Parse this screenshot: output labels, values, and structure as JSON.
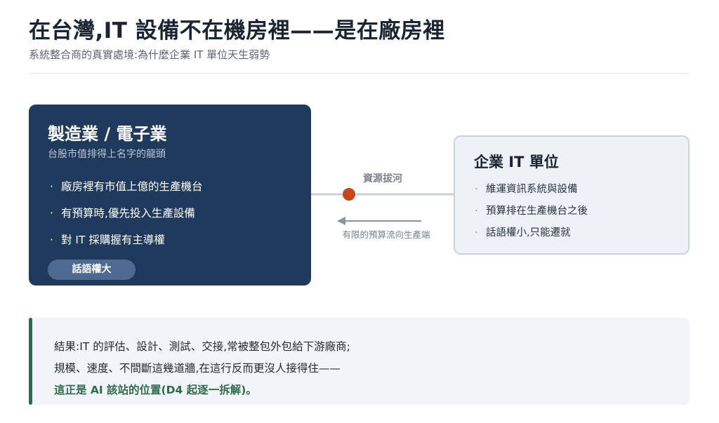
{
  "header": {
    "title": "在台灣,IT 設備不在機房裡——是在廠房裡",
    "subtitle": "系統整合商的真實處境:為什麼企業 IT 單位天生弱勢"
  },
  "left_card": {
    "heading": "製造業 / 電子業",
    "subheading": "台股市值排得上名字的龍頭",
    "bullets": [
      "廠房裡有市值上億的生產機台",
      "有預算時,優先投入生產設備",
      "對 IT 採購握有主導權"
    ],
    "badge": "話語權大"
  },
  "connector": {
    "rope_label": "資源拔河",
    "flow_label": "有限的預算流向生產端"
  },
  "right_card": {
    "heading": "企業 IT 單位",
    "bullets": [
      "維運資訊系統與設備",
      "預算排在生產機台之後",
      "話語權小,只能遷就"
    ]
  },
  "result": {
    "line1": "結果:IT 的評估、設計、測試、交接,常被整包外包給下游廠商;",
    "line2": "規模、速度、不間斷這幾道牆,在這行反而更沒人接得住——",
    "line3": "這正是 AI 該站的位置(D4 起逐一拆解)。"
  },
  "colors": {
    "navy": "#1f3a5c",
    "badge": "#4d6a92",
    "knot": "#c8461b",
    "accent_green": "#2e6b4e",
    "light_panel": "#eef2f7"
  }
}
